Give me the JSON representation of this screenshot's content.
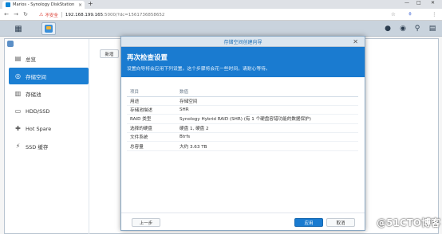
{
  "browser": {
    "tab_title": "Marios - Synology DiskStation",
    "tab_close": "×",
    "new_tab": "+",
    "win_min": "—",
    "win_max": "□",
    "win_close": "✕",
    "back": "←",
    "forward": "→",
    "reload": "↻",
    "warning_icon": "⚠",
    "insecure": "不安全",
    "url_host": "192.168.199.165",
    "url_path": ":5000/?dc=1561736858652",
    "star": "☆",
    "ext": "⚘",
    "menu": "⋮"
  },
  "taskbar": {
    "grid_icon": "▦",
    "chat_icon": "●",
    "user_icon": "◉",
    "search_icon": "⚲",
    "widget_icon": "▤"
  },
  "storage_manager": {
    "new_button": "新增",
    "sidebar": [
      {
        "label": "总览",
        "icon": "▤"
      },
      {
        "label": "存储空间",
        "icon": "◎"
      },
      {
        "label": "存储池",
        "icon": "▥"
      },
      {
        "label": "HDD/SSD",
        "icon": "▭"
      },
      {
        "label": "Hot Spare",
        "icon": "✚"
      },
      {
        "label": "SSD 缓存",
        "icon": "⚡"
      }
    ]
  },
  "wizard": {
    "title": "存储空间创建向导",
    "close": "✕",
    "heading": "再次检查设置",
    "description": "设置向导将会应用下列设置。这个步骤将会花一些时间，请耐心等待。",
    "col_item": "项目",
    "col_value": "数值",
    "rows": [
      {
        "key": "用途",
        "value": "存储空间"
      },
      {
        "key": "存储池描述",
        "value": "SHR"
      },
      {
        "key": "RAID 类型",
        "value": "Synology Hybrid RAID (SHR) (有 1 个硬盘容错功能的数据保护)"
      },
      {
        "key": "选择的硬盘",
        "value": "硬盘 1, 硬盘 2"
      },
      {
        "key": "文件系统",
        "value": "Btrfs"
      },
      {
        "key": "总容量",
        "value": "大约 3.63 TB"
      }
    ],
    "back_button": "上一步",
    "apply_button": "应用",
    "cancel_button": "取消"
  },
  "watermark": "@51CTO博客"
}
